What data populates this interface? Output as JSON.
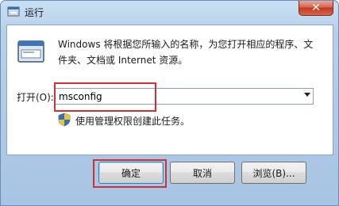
{
  "window": {
    "title": "运行",
    "close_symbol": "✕"
  },
  "dialog": {
    "description": "Windows 将根据您所输入的名称，为您打开相应的程序、文件夹、文档或 Internet 资源。",
    "open_label": "打开(O):",
    "open_value": "msconfig",
    "admin_note": "使用管理权限创建此任务。"
  },
  "buttons": {
    "ok": "确定",
    "cancel": "取消",
    "browse": "浏览(B)..."
  },
  "icons": {
    "title": "run-app-icon",
    "run": "run-program-icon",
    "admin": "uac-shield-icon",
    "close": "close-icon",
    "dropdown": "chevron-down-icon"
  },
  "colors": {
    "highlight": "#d0302e",
    "close_button": "#c23a1f",
    "frame": "#b7d0ea"
  }
}
